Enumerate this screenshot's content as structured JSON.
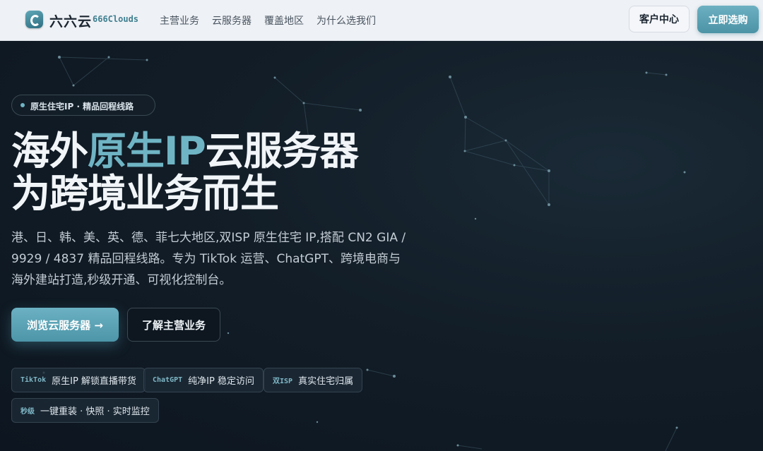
{
  "nav": {
    "brand_cn": "六六云",
    "brand_en": "666Clouds",
    "links": [
      "主营业务",
      "云服务器",
      "覆盖地区",
      "为什么选我们"
    ],
    "client_label": "客户中心",
    "buy_label": "立即选购"
  },
  "hero": {
    "badge": "原生住宅IP · 精品回程线路",
    "title_line1_a": "海外",
    "title_line1_accent": "原生IP",
    "title_line1_b": "云服务器",
    "title_line2": "为跨境业务而生",
    "description": "港、日、韩、美、英、德、菲七大地区,双ISP 原生住宅 IP,搭配 CN2 GIA / 9929 / 4837 精品回程线路。专为 TikTok 运营、ChatGPT、跨境电商与海外建站打造,秒级开通、可视化控制台。",
    "primary_cta": "浏览云服务器 →",
    "secondary_cta": "了解主营业务",
    "tags": [
      {
        "key": "TikTok",
        "text": "原生IP 解锁直播带货"
      },
      {
        "key": "ChatGPT",
        "text": "纯净IP 稳定访问"
      },
      {
        "key": "双ISP",
        "text": "真实住宅归属"
      },
      {
        "key": "秒级",
        "text": "一键重装 · 快照 · 实时监控"
      }
    ]
  },
  "colors": {
    "accent": "#6fb4c4",
    "background": "#0f1a24",
    "nav_bg": "#eef1f5"
  }
}
